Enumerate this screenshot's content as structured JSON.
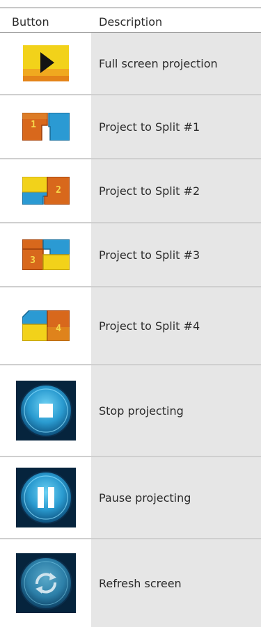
{
  "header": {
    "button_col": "Button",
    "description_col": "Description"
  },
  "rows": [
    {
      "icon": "full-screen-projection-icon",
      "description": "Full screen projection"
    },
    {
      "icon": "split-1-icon",
      "description": "Project to Split #1",
      "number": "1"
    },
    {
      "icon": "split-2-icon",
      "description": "Project to Split #2",
      "number": "2"
    },
    {
      "icon": "split-3-icon",
      "description": "Project to Split #3",
      "number": "3"
    },
    {
      "icon": "split-4-icon",
      "description": "Project to Split #4",
      "number": "4"
    },
    {
      "icon": "stop-icon",
      "description": "Stop projecting"
    },
    {
      "icon": "pause-icon",
      "description": "Pause projecting"
    },
    {
      "icon": "refresh-icon",
      "description": "Refresh screen"
    }
  ],
  "colors": {
    "yellow": "#f2d21a",
    "orange": "#d8681c",
    "blue": "#2b9ad3",
    "dark_blue": "#0c3c66",
    "desc_bg": "#e6e6e6"
  }
}
